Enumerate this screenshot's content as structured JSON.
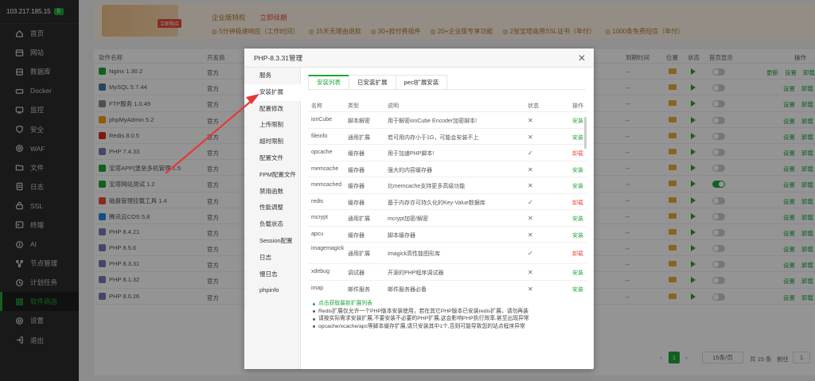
{
  "server": {
    "ip": "103.217.185.15",
    "badge": "0"
  },
  "sidebar": [
    {
      "label": "首页",
      "icon": "home-icon"
    },
    {
      "label": "网站",
      "icon": "globe-icon"
    },
    {
      "label": "数据库",
      "icon": "database-icon"
    },
    {
      "label": "Docker",
      "icon": "docker-icon"
    },
    {
      "label": "监控",
      "icon": "monitor-icon"
    },
    {
      "label": "安全",
      "icon": "shield-icon"
    },
    {
      "label": "WAF",
      "icon": "waf-icon"
    },
    {
      "label": "文件",
      "icon": "folder-icon"
    },
    {
      "label": "日志",
      "icon": "log-icon"
    },
    {
      "label": "SSL",
      "icon": "ssl-icon"
    },
    {
      "label": "终端",
      "icon": "terminal-icon"
    },
    {
      "label": "AI",
      "icon": "ai-icon"
    },
    {
      "label": "节点管理",
      "icon": "node-icon"
    },
    {
      "label": "计划任务",
      "icon": "clock-icon"
    },
    {
      "label": "软件商店",
      "icon": "store-icon",
      "active": true
    },
    {
      "label": "设置",
      "icon": "gear-icon"
    },
    {
      "label": "退出",
      "icon": "logout-icon"
    }
  ],
  "banner": {
    "tag": "立即购买",
    "title": "企业版特权",
    "link": "立即续期",
    "features": [
      "5分钟极速响应（工作时间）",
      "15天无理由退款",
      "30+款付费插件",
      "20+企业版专享功能",
      "2张宝塔商用SSL证书（年付）",
      "1000条免费短信（年付）"
    ]
  },
  "table": {
    "headers": {
      "name": "软件名称",
      "dev": "开发商",
      "expire": "到期时间",
      "location": "位置",
      "status": "状态",
      "home": "首页显示",
      "ops": "操作"
    },
    "rows": [
      {
        "name": "Nginx 1.30.2",
        "dev": "官方",
        "expire": "--",
        "home": false,
        "ops": [
          "更新",
          "设置",
          "卸载"
        ],
        "color": "#20a53a"
      },
      {
        "name": "MySQL 5.7.44",
        "dev": "官方",
        "expire": "--",
        "home": false,
        "ops": [
          "设置",
          "卸载"
        ],
        "color": "#4479a1"
      },
      {
        "name": "FTP服务 1.0.49",
        "dev": "官方",
        "expire": "--",
        "home": false,
        "ops": [
          "设置",
          "卸载"
        ],
        "color": "#888"
      },
      {
        "name": "phpMyAdmin 5.2",
        "dev": "官方",
        "expire": "--",
        "home": false,
        "ops": [
          "设置",
          "卸载"
        ],
        "color": "#f89c0e"
      },
      {
        "name": "Redis 8.0.5",
        "dev": "官方",
        "expire": "--",
        "home": false,
        "ops": [
          "设置",
          "卸载"
        ],
        "color": "#d82c20"
      },
      {
        "name": "PHP 7.4.33",
        "dev": "官方",
        "expire": "--",
        "home": false,
        "ops": [
          "设置",
          "卸载"
        ],
        "color": "#777bb3"
      },
      {
        "name": "宝塔APP(堡垒多机管理 1.5",
        "dev": "官方",
        "expire": "--",
        "home": false,
        "ops": [
          "设置",
          "卸载"
        ],
        "color": "#20a53a"
      },
      {
        "name": "宝塔网站测试 1.2",
        "dev": "官方",
        "expire": "--",
        "home": true,
        "ops": [
          "设置",
          "卸载"
        ],
        "color": "#20a53a"
      },
      {
        "name": "磁盘管理挂载工具 1.4",
        "dev": "官方",
        "expire": "--",
        "home": false,
        "ops": [
          "设置",
          "卸载"
        ],
        "color": "#e84c3d"
      },
      {
        "name": "腾讯云COS 5.8",
        "dev": "官方",
        "expire": "--",
        "home": false,
        "ops": [
          "设置",
          "卸载"
        ],
        "color": "#1e88e5"
      },
      {
        "name": "PHP 8.4.21",
        "dev": "官方",
        "expire": "--",
        "home": false,
        "ops": [
          "设置",
          "卸载"
        ],
        "color": "#777bb3"
      },
      {
        "name": "PHP 8.5.6",
        "dev": "官方",
        "expire": "--",
        "home": false,
        "ops": [
          "设置",
          "卸载"
        ],
        "color": "#777bb3"
      },
      {
        "name": "PHP 8.3.31",
        "dev": "官方",
        "expire": "--",
        "home": false,
        "ops": [
          "设置",
          "卸载"
        ],
        "color": "#777bb3"
      },
      {
        "name": "PHP 8.1.32",
        "dev": "官方",
        "expire": "--",
        "home": false,
        "ops": [
          "设置",
          "卸载"
        ],
        "color": "#777bb3"
      },
      {
        "name": "PHP 8.0.26",
        "dev": "官方",
        "expire": "--",
        "home": false,
        "ops": [
          "设置",
          "卸载"
        ],
        "color": "#777bb3"
      }
    ]
  },
  "pager": {
    "current": "1",
    "per_page": "15条/页",
    "total": "共 15 条",
    "goto": "前往",
    "goto_value": "1"
  },
  "modal": {
    "title": "PHP-8.3.31管理",
    "menu": [
      "服务",
      "安装扩展",
      "配置修改",
      "上传限制",
      "超时限制",
      "配置文件",
      "FPM配置文件",
      "禁用函数",
      "性能调整",
      "负载状态",
      "Session配置",
      "日志",
      "慢日志",
      "phpinfo"
    ],
    "active_menu": 1,
    "tabs": [
      "安装列表",
      "已安装扩展",
      "pecl扩展安装"
    ],
    "active_tab": 0,
    "columns": {
      "name": "名称",
      "type": "类型",
      "desc": "说明",
      "status": "状态",
      "action": "操作"
    },
    "extensions": [
      {
        "name": "ionCube",
        "type": "脚本解密",
        "desc": "用于解密ionCube Encoder加密脚本!",
        "status": "✕",
        "action": "安装"
      },
      {
        "name": "fileinfo",
        "type": "通用扩展",
        "desc": "若可用内存小于1G，可能会安装不上",
        "status": "✕",
        "action": "安装"
      },
      {
        "name": "opcache",
        "type": "缓存器",
        "desc": "用于加速PHP脚本!",
        "status": "✓",
        "action": "卸载"
      },
      {
        "name": "memcache",
        "type": "缓存器",
        "desc": "强大的内容缓存器",
        "status": "✕",
        "action": "安装"
      },
      {
        "name": "memcached",
        "type": "缓存器",
        "desc": "比memcache支持更多高级功能",
        "status": "✕",
        "action": "安装"
      },
      {
        "name": "redis",
        "type": "缓存器",
        "desc": "基于内存亦可持久化的Key-Value数据库",
        "status": "✓",
        "action": "卸载"
      },
      {
        "name": "mcrypt",
        "type": "通用扩展",
        "desc": "mcrypt加密/解密",
        "status": "✕",
        "action": "安装"
      },
      {
        "name": "apcu",
        "type": "缓存器",
        "desc": "脚本缓存器",
        "status": "✕",
        "action": "安装"
      },
      {
        "name": "imagemagick",
        "type": "通用扩展",
        "desc": "Imagick高性能图形库",
        "status": "✓",
        "action": "卸载"
      },
      {
        "name": "xdebug",
        "type": "调试器",
        "desc": "开源的PHP程序调试器",
        "status": "✕",
        "action": "安装"
      },
      {
        "name": "imap",
        "type": "邮件服务",
        "desc": "邮件服务器必备",
        "status": "✕",
        "action": "安装"
      }
    ],
    "notes": [
      "点击获取最新扩展列表",
      "Redis扩展仅允许一个PHP版本安装使用，若在其它PHP版本已安装redis扩展，请勿再装",
      "请按实际需求安装扩展,不要安装不必要的PHP扩展,这会影响PHP执行效率,甚至出现异常",
      "opcache/xcache/apc等脚本缓存扩展,请只安装其中1个,否则可能导致您的站点程序异常"
    ]
  },
  "colors": {
    "accent": "#20a53a",
    "danger": "#e84c3d",
    "arrow": "#e53935"
  }
}
